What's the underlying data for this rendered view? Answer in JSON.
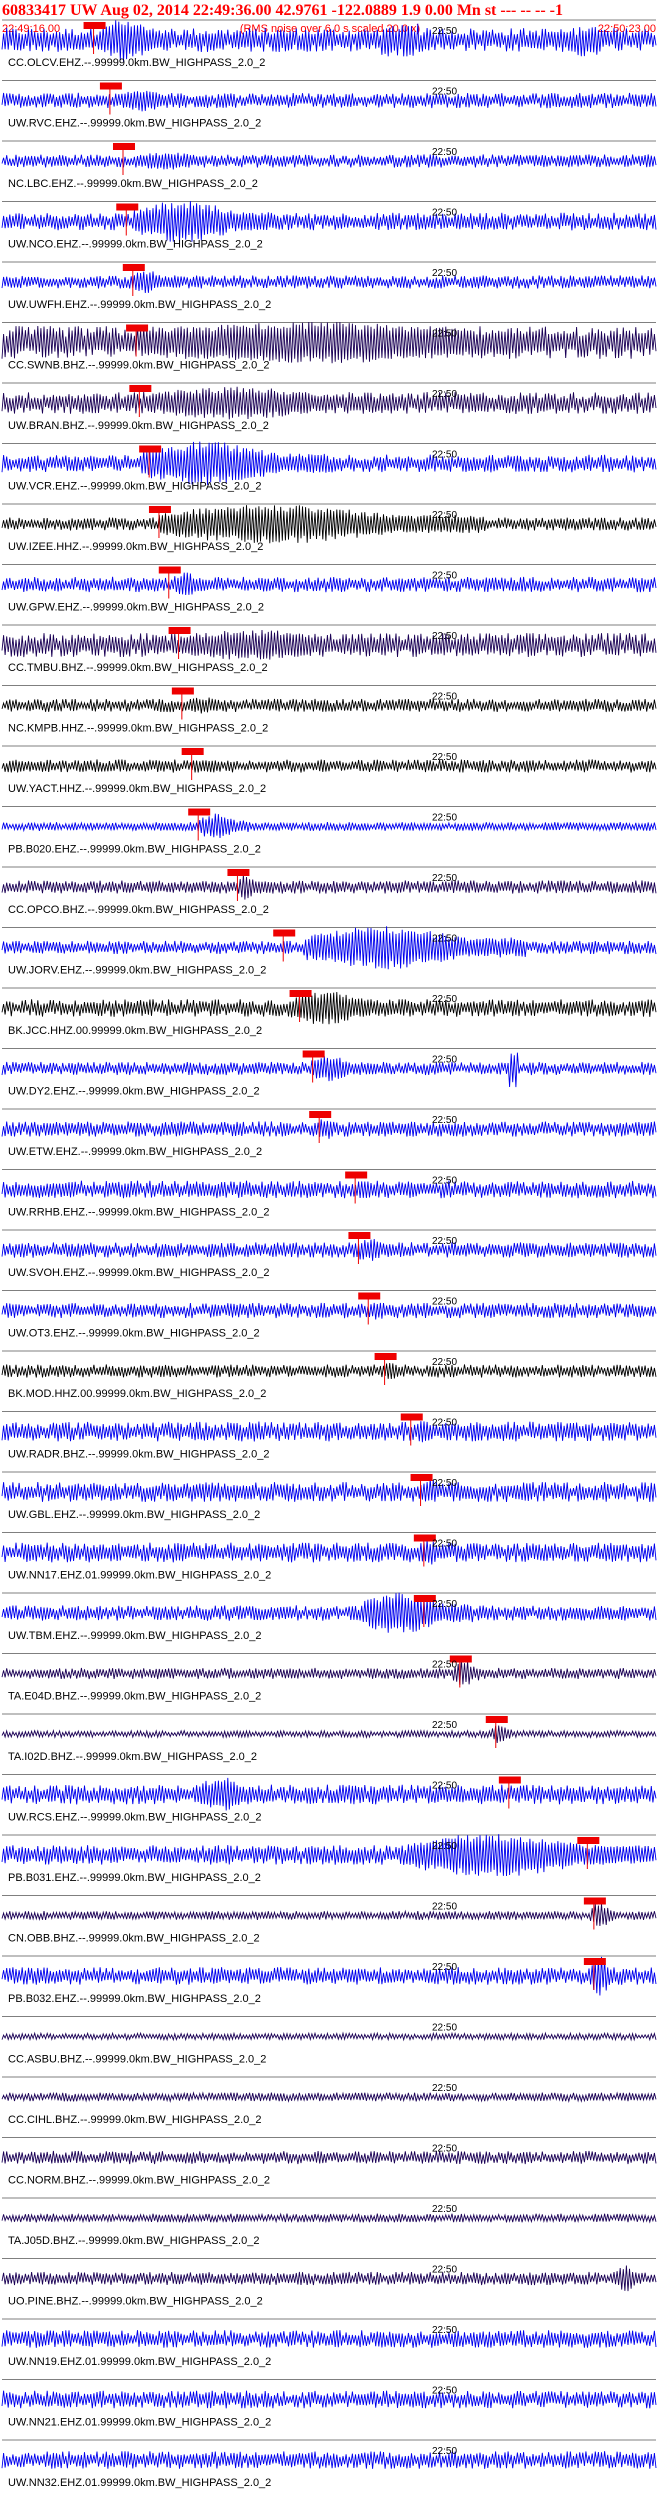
{
  "header": {
    "title": "60833417 UW Aug 02, 2014 22:49:36.00   42.9761 -122.0889  1.9 0.00 Mn st --- -- --   -1",
    "start_time": "22:49:16.00",
    "note": "(RMS noise over 6.0 s scaled 20.0 x)",
    "end_time": "22:50:23.00"
  },
  "chart_data": {
    "type": "line",
    "time_window": {
      "start": "22:49:16.00",
      "end": "22:50:23.00"
    },
    "time_marker_label": "22:50",
    "traces": [
      {
        "label": "CC.OLCV.EHZ.--.99999.0km.BW_HIGHPASS_2.0_2",
        "color": "#0000ee",
        "amplitude": 0.55,
        "event_start": 0.15,
        "event_end": 0.26,
        "event_amp": 1.0,
        "pick": 0.14,
        "extra_bursts": [
          [
            0.58,
            0.64,
            0.75
          ],
          [
            0.88,
            0.91,
            0.8
          ]
        ]
      },
      {
        "label": "UW.RVC.EHZ.--.99999.0km.BW_HIGHPASS_2.0_2",
        "color": "#0000ee",
        "amplitude": 0.35,
        "event_start": 0.18,
        "event_end": 0.28,
        "event_amp": 0.5,
        "pick": 0.165
      },
      {
        "label": "NC.LBC.EHZ.--.99999.0km.BW_HIGHPASS_2.0_2",
        "color": "#0000ee",
        "amplitude": 0.3,
        "event_start": 0.2,
        "event_end": 0.35,
        "event_amp": 0.4,
        "pick": 0.185
      },
      {
        "label": "UW.NCO.EHZ.--.99999.0km.BW_HIGHPASS_2.0_2",
        "color": "#0000ee",
        "amplitude": 0.4,
        "event_start": 0.2,
        "event_end": 0.42,
        "event_amp": 0.95,
        "pick": 0.19
      },
      {
        "label": "UW.UWFH.EHZ.--.99999.0km.BW_HIGHPASS_2.0_2",
        "color": "#0000ee",
        "amplitude": 0.3,
        "event_start": 0.2,
        "event_end": 0.26,
        "event_amp": 0.55,
        "pick": 0.2
      },
      {
        "label": "CC.SWNB.BHZ.--.99999.0km.BW_HIGHPASS_2.0_2",
        "color": "#1a0055",
        "amplitude": 0.75,
        "event_start": 0.21,
        "event_end": 0.98,
        "event_amp": 0.95,
        "pick": 0.205
      },
      {
        "label": "UW.BRAN.BHZ.--.99999.0km.BW_HIGHPASS_2.0_2",
        "color": "#1a0055",
        "amplitude": 0.5,
        "event_start": 0.22,
        "event_end": 0.6,
        "event_amp": 0.75,
        "pick": 0.21
      },
      {
        "label": "UW.VCR.EHZ.--.99999.0km.BW_HIGHPASS_2.0_2",
        "color": "#0000ee",
        "amplitude": 0.4,
        "event_start": 0.21,
        "event_end": 0.5,
        "event_amp": 1.0,
        "pick": 0.225
      },
      {
        "label": "UW.IZEE.HHZ.--.99999.0km.BW_HIGHPASS_2.0_2",
        "color": "#000000",
        "amplitude": 0.3,
        "event_start": 0.24,
        "event_end": 0.74,
        "event_amp": 0.9,
        "pick": 0.24
      },
      {
        "label": "UW.GPW.EHZ.--.99999.0km.BW_HIGHPASS_2.0_2",
        "color": "#0000ee",
        "amplitude": 0.35,
        "event_start": 0.26,
        "event_end": 0.32,
        "event_amp": 0.55,
        "pick": 0.255
      },
      {
        "label": "CC.TMBU.BHZ.--.99999.0km.BW_HIGHPASS_2.0_2",
        "color": "#1a0055",
        "amplitude": 0.55,
        "event_start": 0.27,
        "event_end": 0.6,
        "event_amp": 0.7,
        "pick": 0.27
      },
      {
        "label": "NC.KMPB.HHZ.--.99999.0km.BW_HIGHPASS_2.0_2",
        "color": "#000000",
        "amplitude": 0.3,
        "event_start": 0.28,
        "event_end": 0.36,
        "event_amp": 0.4,
        "pick": 0.275
      },
      {
        "label": "UW.YACT.HHZ.--.99999.0km.BW_HIGHPASS_2.0_2",
        "color": "#000000",
        "amplitude": 0.3,
        "event_start": 0.29,
        "event_end": 0.35,
        "event_amp": 0.35,
        "pick": 0.29
      },
      {
        "label": "PB.B020.EHZ.--.99999.0km.BW_HIGHPASS_2.0_2",
        "color": "#0000ee",
        "amplitude": 0.2,
        "event_start": 0.3,
        "event_end": 0.38,
        "event_amp": 0.6,
        "pick": 0.3
      },
      {
        "label": "CC.OPCO.BHZ.--.99999.0km.BW_HIGHPASS_2.0_2",
        "color": "#1a0055",
        "amplitude": 0.3,
        "event_start": 0.36,
        "event_end": 0.4,
        "event_amp": 0.6,
        "pick": 0.36
      },
      {
        "label": "UW.JORV.EHZ.--.99999.0km.BW_HIGHPASS_2.0_2",
        "color": "#0000ee",
        "amplitude": 0.3,
        "event_start": 0.46,
        "event_end": 0.8,
        "event_amp": 1.0,
        "pick": 0.43
      },
      {
        "label": "BK.JCC.HHZ.00.99999.0km.BW_HIGHPASS_2.0_2",
        "color": "#000000",
        "amplitude": 0.4,
        "event_start": 0.44,
        "event_end": 0.6,
        "event_amp": 0.8,
        "pick": 0.455
      },
      {
        "label": "UW.DY2.EHZ.--.99999.0km.BW_HIGHPASS_2.0_2",
        "color": "#0000ee",
        "amplitude": 0.3,
        "event_start": 0.47,
        "event_end": 0.56,
        "event_amp": 0.6,
        "pick": 0.475,
        "extra_bursts": [
          [
            0.775,
            0.79,
            0.9
          ]
        ]
      },
      {
        "label": "UW.ETW.EHZ.--.99999.0km.BW_HIGHPASS_2.0_2",
        "color": "#0000ee",
        "amplitude": 0.35,
        "event_start": 0.48,
        "event_end": 0.52,
        "event_amp": 0.5,
        "pick": 0.485
      },
      {
        "label": "UW.RRHB.EHZ.--.99999.0km.BW_HIGHPASS_2.0_2",
        "color": "#0000ee",
        "amplitude": 0.4,
        "event_start": 0.54,
        "event_end": 0.58,
        "event_amp": 0.5,
        "pick": 0.54
      },
      {
        "label": "UW.SVOH.EHZ.--.99999.0km.BW_HIGHPASS_2.0_2",
        "color": "#0000ee",
        "amplitude": 0.35,
        "event_start": 0.54,
        "event_end": 0.6,
        "event_amp": 0.55,
        "pick": 0.545
      },
      {
        "label": "UW.OT3.EHZ.--.99999.0km.BW_HIGHPASS_2.0_2",
        "color": "#0000ee",
        "amplitude": 0.35,
        "event_start": 0.56,
        "event_end": 0.6,
        "event_amp": 0.45,
        "pick": 0.56
      },
      {
        "label": "BK.MOD.HHZ.00.99999.0km.BW_HIGHPASS_2.0_2",
        "color": "#000000",
        "amplitude": 0.3,
        "event_start": 0.58,
        "event_end": 0.62,
        "event_amp": 0.4,
        "pick": 0.585
      },
      {
        "label": "UW.RADR.BHZ.--.99999.0km.BW_HIGHPASS_2.0_2",
        "color": "#0000ee",
        "amplitude": 0.45,
        "event_start": 0.63,
        "event_end": 0.67,
        "event_amp": 0.55,
        "pick": 0.625
      },
      {
        "label": "UW.GBL.EHZ.--.99999.0km.BW_HIGHPASS_2.0_2",
        "color": "#0000ee",
        "amplitude": 0.45,
        "event_start": 0.64,
        "event_end": 0.68,
        "event_amp": 0.6,
        "pick": 0.64
      },
      {
        "label": "UW.NN17.EHZ.01.99999.0km.BW_HIGHPASS_2.0_2",
        "color": "#0000ee",
        "amplitude": 0.45,
        "event_start": 0.64,
        "event_end": 0.68,
        "event_amp": 0.6,
        "pick": 0.645
      },
      {
        "label": "UW.TBM.EHZ.--.99999.0km.BW_HIGHPASS_2.0_2",
        "color": "#0000ee",
        "amplitude": 0.35,
        "event_start": 0.55,
        "event_end": 0.72,
        "event_amp": 0.95,
        "pick": 0.645
      },
      {
        "label": "TA.E04D.BHZ.--.99999.0km.BW_HIGHPASS_2.0_2",
        "color": "#1a0055",
        "amplitude": 0.25,
        "event_start": 0.69,
        "event_end": 0.73,
        "event_amp": 0.7,
        "pick": 0.7
      },
      {
        "label": "TA.I02D.BHZ.--.99999.0km.BW_HIGHPASS_2.0_2",
        "color": "#1a0055",
        "amplitude": 0.15,
        "event_start": 0.75,
        "event_end": 0.78,
        "event_amp": 0.5,
        "pick": 0.755
      },
      {
        "label": "UW.RCS.EHZ.--.99999.0km.BW_HIGHPASS_2.0_2",
        "color": "#0000ee",
        "amplitude": 0.45,
        "event_start": 0.3,
        "event_end": 0.4,
        "event_amp": 0.8,
        "pick": 0.775
      },
      {
        "label": "PB.B031.EHZ.--.99999.0km.BW_HIGHPASS_2.0_2",
        "color": "#0000ee",
        "amplitude": 0.45,
        "event_start": 0.62,
        "event_end": 0.99,
        "event_amp": 1.0,
        "pick": 0.895
      },
      {
        "label": "CN.OBB.BHZ.--.99999.0km.BW_HIGHPASS_2.0_2",
        "color": "#1a0055",
        "amplitude": 0.2,
        "event_start": 0.9,
        "event_end": 0.94,
        "event_amp": 0.6,
        "pick": 0.905
      },
      {
        "label": "PB.B032.EHZ.--.99999.0km.BW_HIGHPASS_2.0_2",
        "color": "#0000ee",
        "amplitude": 0.4,
        "event_start": 0.9,
        "event_end": 0.94,
        "event_amp": 0.9,
        "pick": 0.905
      },
      {
        "label": "CC.ASBU.BHZ.--.99999.0km.BW_HIGHPASS_2.0_2",
        "color": "#1a0055",
        "amplitude": 0.15
      },
      {
        "label": "CC.CIHL.BHZ.--.99999.0km.BW_HIGHPASS_2.0_2",
        "color": "#1a0055",
        "amplitude": 0.2
      },
      {
        "label": "CC.NORM.BHZ.--.99999.0km.BW_HIGHPASS_2.0_2",
        "color": "#1a0055",
        "amplitude": 0.3
      },
      {
        "label": "TA.J05D.BHZ.--.99999.0km.BW_HIGHPASS_2.0_2",
        "color": "#1a0055",
        "amplitude": 0.2
      },
      {
        "label": "UO.PINE.BHZ.--.99999.0km.BW_HIGHPASS_2.0_2",
        "color": "#1a0055",
        "amplitude": 0.3,
        "event_start": 0.94,
        "event_end": 0.98,
        "event_amp": 0.6
      },
      {
        "label": "UW.NN19.EHZ.01.99999.0km.BW_HIGHPASS_2.0_2",
        "color": "#0000ee",
        "amplitude": 0.4
      },
      {
        "label": "UW.NN21.EHZ.01.99999.0km.BW_HIGHPASS_2.0_2",
        "color": "#0000ee",
        "amplitude": 0.4
      },
      {
        "label": "UW.NN32.EHZ.01.99999.0km.BW_HIGHPASS_2.0_2",
        "color": "#0000ee",
        "amplitude": 0.4
      }
    ]
  }
}
